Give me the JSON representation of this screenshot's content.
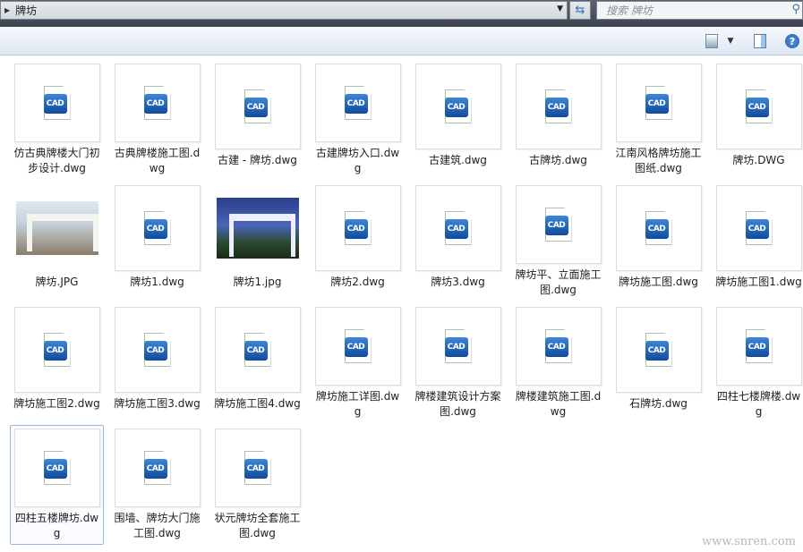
{
  "address": {
    "path": "牌坊"
  },
  "search": {
    "placeholder": "搜索 牌坊"
  },
  "toolbar": {
    "help": "?"
  },
  "cad_icon_text": "CAD",
  "files": [
    {
      "name": "仿古典牌楼大门初步设计.dwg",
      "type": "dwg"
    },
    {
      "name": "古典牌楼施工图.dwg",
      "type": "dwg"
    },
    {
      "name": "古建 - 牌坊.dwg",
      "type": "dwg"
    },
    {
      "name": "古建牌坊入口.dwg",
      "type": "dwg"
    },
    {
      "name": "古建筑.dwg",
      "type": "dwg"
    },
    {
      "name": "古牌坊.dwg",
      "type": "dwg"
    },
    {
      "name": "江南风格牌坊施工图纸.dwg",
      "type": "dwg"
    },
    {
      "name": "牌坊.DWG",
      "type": "dwg"
    },
    {
      "name": "牌坊.JPG",
      "type": "jpg1"
    },
    {
      "name": "牌坊1.dwg",
      "type": "dwg"
    },
    {
      "name": "牌坊1.jpg",
      "type": "jpg2"
    },
    {
      "name": "牌坊2.dwg",
      "type": "dwg"
    },
    {
      "name": "牌坊3.dwg",
      "type": "dwg"
    },
    {
      "name": "牌坊平、立面施工图.dwg",
      "type": "dwg"
    },
    {
      "name": "牌坊施工图.dwg",
      "type": "dwg"
    },
    {
      "name": "牌坊施工图1.dwg",
      "type": "dwg"
    },
    {
      "name": "牌坊施工图2.dwg",
      "type": "dwg"
    },
    {
      "name": "牌坊施工图3.dwg",
      "type": "dwg"
    },
    {
      "name": "牌坊施工图4.dwg",
      "type": "dwg"
    },
    {
      "name": "牌坊施工详图.dwg",
      "type": "dwg"
    },
    {
      "name": "牌楼建筑设计方案图.dwg",
      "type": "dwg"
    },
    {
      "name": "牌楼建筑施工图.dwg",
      "type": "dwg"
    },
    {
      "name": "石牌坊.dwg",
      "type": "dwg"
    },
    {
      "name": "四柱七楼牌楼.dwg",
      "type": "dwg"
    },
    {
      "name": "四柱五楼牌坊.dwg",
      "type": "dwg",
      "selected": true
    },
    {
      "name": "围墙、牌坊大门施工图.dwg",
      "type": "dwg"
    },
    {
      "name": "状元牌坊全套施工图.dwg",
      "type": "dwg"
    }
  ],
  "watermark": "www.snren.com"
}
